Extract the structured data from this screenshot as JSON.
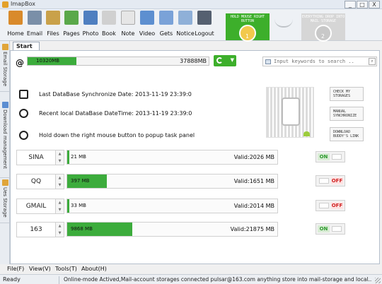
{
  "window": {
    "title": "ImapBox",
    "min": "_",
    "max": "□",
    "close": "X"
  },
  "toolbar": [
    {
      "label": "Home",
      "icon": "home-icon",
      "color": "#d98a2b"
    },
    {
      "label": "Email",
      "icon": "email-icon",
      "color": "#7a8fa8"
    },
    {
      "label": "Files",
      "icon": "files-icon",
      "color": "#c9a14a"
    },
    {
      "label": "Pages",
      "icon": "pages-icon",
      "color": "#5aa84a"
    },
    {
      "label": "Photo",
      "icon": "photo-icon",
      "color": "#4f7fc0"
    },
    {
      "label": "Book",
      "icon": "book-icon",
      "color": "#d0d0d0"
    },
    {
      "label": "Note",
      "icon": "note-icon",
      "color": "#e6e6e6"
    },
    {
      "label": "Video",
      "icon": "video-icon",
      "color": "#5d8fd0"
    },
    {
      "label": "Gets",
      "icon": "gets-icon",
      "color": "#7aa2d8"
    },
    {
      "label": "Notice",
      "icon": "notice-icon",
      "color": "#8fb0d8"
    },
    {
      "label": "Logout",
      "icon": "logout-icon",
      "color": "#556070"
    }
  ],
  "tips": {
    "step1_text": "HOLD MOUSE RIGHT BUTTON",
    "step1_num": "1",
    "step2_text": "EVERYTHING DROP INTO MAIL STORAGE",
    "step2_num": "2"
  },
  "sidebar": [
    "Email Storage",
    "Download management",
    "Ues Storage"
  ],
  "tab": "Start",
  "storage": {
    "used": "10320MB",
    "total": "37888MB",
    "fill_ratio": 0.27,
    "search_placeholder": "Input keywords to search .."
  },
  "info": {
    "sync_label": "Last DataBase Synchronize Date:",
    "sync_value": "2013-11-19 23:39:0",
    "local_label": "Recent local DataBase DateTime:",
    "local_value": "2013-11-19 23:39:0",
    "hint": "Hold down the right mouse button to popup task panel"
  },
  "side_buttons": [
    "CHECK MY STORAGES",
    "MANUAL SYNCHRONIZE",
    "DOWNLOAD BUDDY'S LINK"
  ],
  "accounts": [
    {
      "name": "SINA",
      "used": "21 MB",
      "valid": "Valid:2026 MB",
      "fill_ratio": 0.01,
      "state": "ON"
    },
    {
      "name": "QQ",
      "used": "397 MB",
      "valid": "Valid:1651 MB",
      "fill_ratio": 0.19,
      "state": "OFF"
    },
    {
      "name": "GMAIL",
      "used": "33 MB",
      "valid": "Valid:2014 MB",
      "fill_ratio": 0.01,
      "state": "OFF"
    },
    {
      "name": "163",
      "used": "9868 MB",
      "valid": "Valid:21875 MB",
      "fill_ratio": 0.31,
      "state": "ON"
    }
  ],
  "menu": [
    "File(F)",
    "View(V)",
    "Tools(T)",
    "About(H)"
  ],
  "status": {
    "left": "Ready",
    "message": "Online-mode Actived,Mail-account storages connected pulsar@163.com anything store into mail-storage and local.."
  }
}
